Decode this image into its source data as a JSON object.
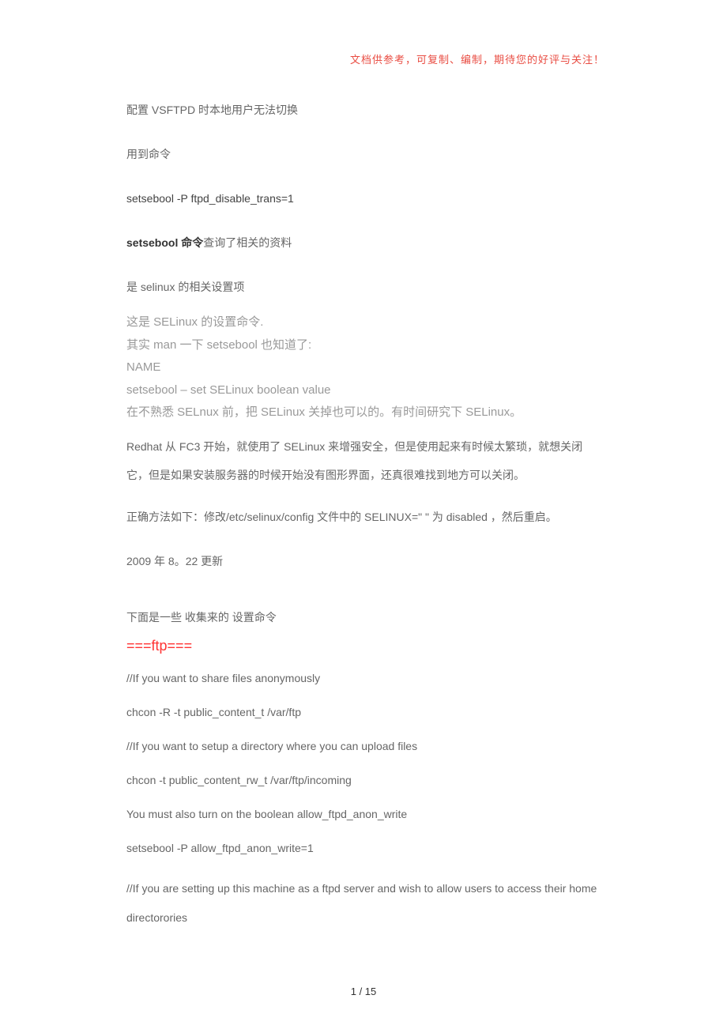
{
  "header_note": "文档供参考，可复制、编制，期待您的好评与关注！",
  "title_line": "配置 VSFTPD 时本地用户无法切换",
  "cmd_intro": "用到命令",
  "cmd1": "setsebool -P ftpd_disable_trans=1",
  "q_prefix_bold": "setsebool 命令",
  "q_suffix": "查询了相关的资料",
  "selinux_note": "是 selinux 的相关设置项",
  "gray": {
    "l1": "这是 SELinux 的设置命令.",
    "l2": "其实 man 一下 setsebool 也知道了:",
    "l3": "NAME",
    "l4": "setsebool – set SELinux boolean value",
    "l5": "在不熟悉 SELnux 前，把 SELinux 关掉也可以的。有时间研究下 SELinux。"
  },
  "redhat_para": "Redhat 从 FC3 开始，就使用了 SELinux 来增强安全，但是使用起来有时候太繁琐，就想关闭它，但是如果安装服务器的时候开始没有图形界面，还真很难找到地方可以关闭。",
  "method_line": "正确方法如下：修改/etc/selinux/config 文件中的 SELINUX=\" \" 为 disabled ，然后重启。",
  "update_line": "2009 年 8。22 更新",
  "collected_intro": "下面是一些 收集来的 设置命令",
  "ftp_heading": "===ftp===",
  "ftp": {
    "c1": "//If you want to share files anonymously",
    "c2": "chcon -R -t public_content_t /var/ftp",
    "c3": "//If you want to setup a directory where you can upload files",
    "c4": "chcon -t public_content_rw_t /var/ftp/incoming",
    "c5": "You must also turn on the boolean allow_ftpd_anon_write",
    "c6": "setsebool -P allow_ftpd_anon_write=1",
    "c7": "//If you are setting up this machine as a ftpd server and wish to allow users to access their home directorories"
  },
  "footer": "1 / 15"
}
